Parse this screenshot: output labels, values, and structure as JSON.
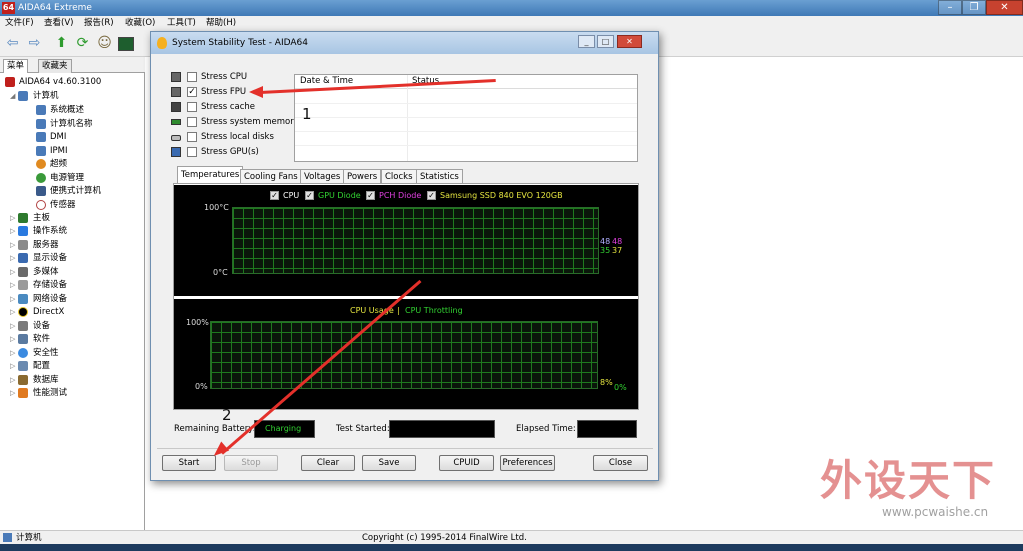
{
  "main_window": {
    "title": "AIDA64 Extreme",
    "app_icon_text": "64"
  },
  "menu": [
    "文件(F)",
    "查看(V)",
    "报告(R)",
    "收藏(O)",
    "工具(T)",
    "帮助(H)"
  ],
  "left_tabs": [
    "菜单",
    "收藏夹"
  ],
  "tree": {
    "root": "AIDA64 v4.60.3100",
    "computer": "计算机",
    "computer_children": [
      "系统概述",
      "计算机名称",
      "DMI",
      "IPMI",
      "超频",
      "电源管理",
      "便携式计算机",
      "传感器"
    ],
    "top_nodes": [
      "主板",
      "操作系统",
      "服务器",
      "显示设备",
      "多媒体",
      "存储设备",
      "网络设备",
      "DirectX",
      "设备",
      "软件",
      "安全性",
      "配置",
      "数据库",
      "性能测试"
    ]
  },
  "status_bar": {
    "left": "计算机",
    "center": "Copyright (c) 1995-2014 FinalWire Ltd."
  },
  "dialog": {
    "title": "System Stability Test - AIDA64",
    "stress_options": [
      {
        "label": "Stress CPU",
        "checked": false
      },
      {
        "label": "Stress FPU",
        "checked": true
      },
      {
        "label": "Stress cache",
        "checked": false
      },
      {
        "label": "Stress system memory",
        "checked": false
      },
      {
        "label": "Stress local disks",
        "checked": false
      },
      {
        "label": "Stress GPU(s)",
        "checked": false
      }
    ],
    "list_columns": [
      "Date & Time",
      "Status"
    ],
    "graph_tabs": [
      "Temperatures",
      "Cooling Fans",
      "Voltages",
      "Powers",
      "Clocks",
      "Statistics"
    ],
    "active_tab": "Temperatures",
    "temp_graph": {
      "legend": [
        {
          "label": "CPU",
          "color": "#ffffff"
        },
        {
          "label": "GPU Diode",
          "color": "#32d232"
        },
        {
          "label": "PCH Diode",
          "color": "#e040e0"
        },
        {
          "label": "Samsung SSD 840 EVO 120GB",
          "color": "#e6e640"
        }
      ],
      "y_top": "100°C",
      "y_bottom": "0°C",
      "readouts": [
        {
          "value": "48",
          "color": "#b0b0ff"
        },
        {
          "value": "48",
          "color": "#e040e0"
        },
        {
          "value": "35",
          "color": "#32d232"
        },
        {
          "value": "37",
          "color": "#e6e640"
        }
      ]
    },
    "usage_graph": {
      "title_a": "CPU Usage",
      "separator": "|",
      "title_b": "CPU Throttling",
      "title_a_color": "#e6e640",
      "title_b_color": "#32d232",
      "y_top": "100%",
      "y_bottom": "0%",
      "readout_a": "8%",
      "readout_b": "0%"
    },
    "remaining_battery_label": "Remaining Battery:",
    "battery_status": "Charging",
    "test_started_label": "Test Started:",
    "elapsed_time_label": "Elapsed Time:",
    "buttons": {
      "start": "Start",
      "stop": "Stop",
      "clear": "Clear",
      "save": "Save",
      "cpuid": "CPUID",
      "preferences": "Preferences",
      "close": "Close"
    }
  },
  "annotations": {
    "one": "1",
    "two": "2"
  },
  "watermark": {
    "text": "外设天下",
    "url": "www.pcwaishe.cn"
  }
}
